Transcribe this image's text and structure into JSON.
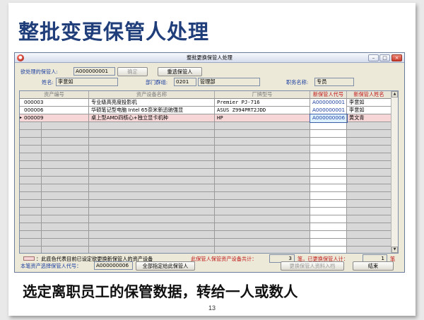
{
  "slide": {
    "title": "整批变更保管人处理",
    "caption": "选定离职员工的保管数据，转给一人或数人",
    "page_number": "13"
  },
  "window": {
    "title": "整批更换保管人处理",
    "minimize": "–",
    "maximize": "□",
    "close": "×",
    "icon_glyph": "●"
  },
  "form": {
    "custodian_label": "欲处理的保管人:",
    "custodian_value": "A000000001",
    "confirm_button": "确定",
    "reselect_button": "重选保管人",
    "name_label": "姓名:",
    "name_value": "李意如",
    "dept_label": "部门群组:",
    "dept_code": "0201",
    "dept_name": "管理部",
    "job_label": "职务名称:",
    "job_value": "专员"
  },
  "grid": {
    "columns": [
      "资产编号",
      "资产设备名称",
      "厂牌型号",
      "新保管人代号",
      "新保管人姓名"
    ],
    "rows": [
      {
        "asset_no": "000003",
        "asset_name": "专业级高亮度投影机",
        "model": "Premier PJ-716",
        "new_code": "A000000001",
        "new_name": "李意如",
        "highlight": false,
        "current": false
      },
      {
        "asset_no": "000006",
        "asset_name": "华硕笔记型电脑 Intel 65奈米新迅驰强显",
        "model": "ASUS Z994PRT2JDD",
        "new_code": "A000000001",
        "new_name": "李意如",
        "highlight": false,
        "current": false
      },
      {
        "asset_no": "000009",
        "asset_name": "桌上型AMD四核心+独立显卡机种",
        "model": "HP",
        "new_code": "A000000006",
        "new_name": "黄文青",
        "highlight": true,
        "current": true
      }
    ],
    "row_marker": "▸",
    "scroll_up": "▲",
    "scroll_down": "▼"
  },
  "footer": {
    "legend_text": "：此底色代表目前已设定欲更换新保管人的资产设备",
    "total_label": "此保管人保管资产设备共计：",
    "total_value": "3",
    "changed_label": "笔，已更换保管人计：",
    "changed_value": "1",
    "unit": "笔",
    "select_label": "本笔资产选择保管人代号：",
    "select_value": "A000000006",
    "assign_all_button": "全部指定给此保管人",
    "write_button": "更换保管人资料入档",
    "exit_button": "结束"
  },
  "colors": {
    "title": "#1f3e7a",
    "highlight_row": "#f6d6d6",
    "code_blue": "#1c3fa0",
    "label_red": "#c01818"
  }
}
